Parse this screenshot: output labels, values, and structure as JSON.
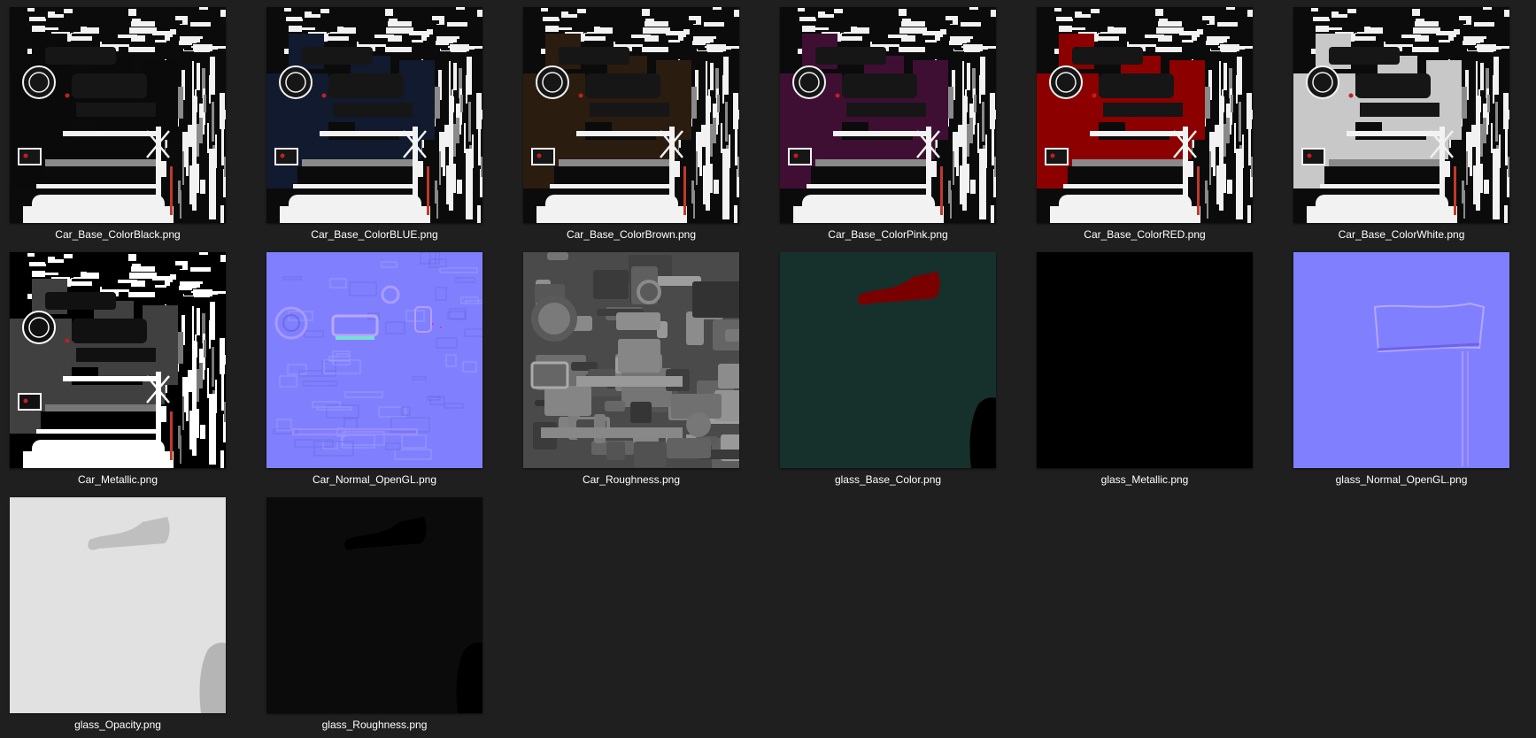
{
  "files": [
    {
      "name": "Car_Base_ColorBlack.png",
      "kind": "basecolor",
      "accent": "#0a0a0a"
    },
    {
      "name": "Car_Base_ColorBLUE.png",
      "kind": "basecolor",
      "accent": "#111a2e"
    },
    {
      "name": "Car_Base_ColorBrown.png",
      "kind": "basecolor",
      "accent": "#2b1c10"
    },
    {
      "name": "Car_Base_ColorPink.png",
      "kind": "basecolor",
      "accent": "#3f0f33"
    },
    {
      "name": "Car_Base_ColorRED.png",
      "kind": "basecolor",
      "accent": "#8c0000"
    },
    {
      "name": "Car_Base_ColorWhite.png",
      "kind": "basecolor",
      "accent": "#c8c8c8"
    },
    {
      "name": "Car_Metallic.png",
      "kind": "metallic",
      "accent": "#404040"
    },
    {
      "name": "Car_Normal_OpenGL.png",
      "kind": "normal",
      "accent": "#8080ff"
    },
    {
      "name": "Car_Roughness.png",
      "kind": "roughness",
      "accent": "#555555"
    },
    {
      "name": "glass_Base_Color.png",
      "kind": "glasscolor",
      "accent": "#16302c"
    },
    {
      "name": "glass_Metallic.png",
      "kind": "flat",
      "accent": "#000000"
    },
    {
      "name": "glass_Normal_OpenGL.png",
      "kind": "glassnormal",
      "accent": "#8080ff"
    },
    {
      "name": "glass_Opacity.png",
      "kind": "opacity",
      "accent": "#e1e1e1"
    },
    {
      "name": "glass_Roughness.png",
      "kind": "glassrough",
      "accent": "#0b0b0b"
    }
  ],
  "colors": {
    "background": "#1f1f1f",
    "caption": "#ffffff"
  }
}
